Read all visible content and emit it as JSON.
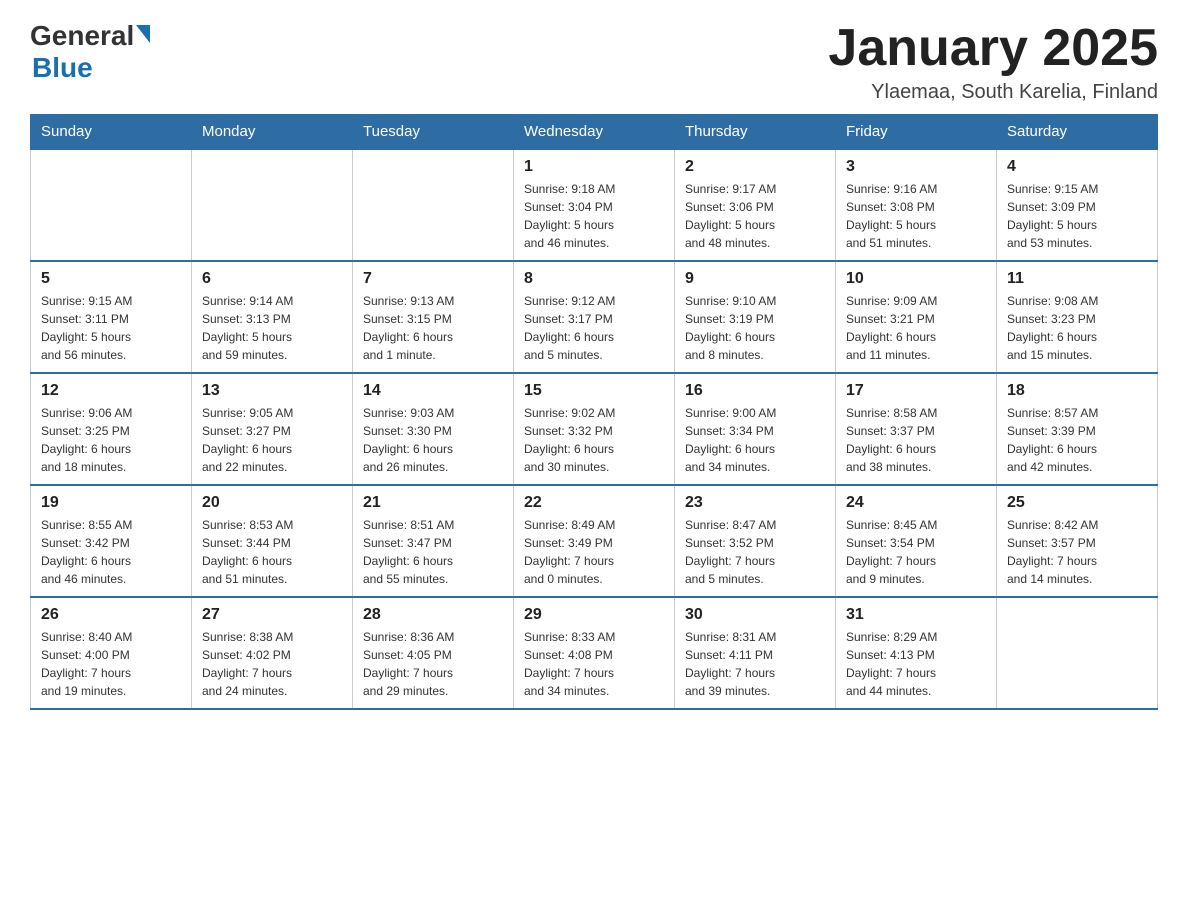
{
  "logo": {
    "general": "General",
    "blue": "Blue"
  },
  "header": {
    "title": "January 2025",
    "location": "Ylaemaa, South Karelia, Finland"
  },
  "weekdays": [
    "Sunday",
    "Monday",
    "Tuesday",
    "Wednesday",
    "Thursday",
    "Friday",
    "Saturday"
  ],
  "weeks": [
    [
      {
        "day": "",
        "info": ""
      },
      {
        "day": "",
        "info": ""
      },
      {
        "day": "",
        "info": ""
      },
      {
        "day": "1",
        "info": "Sunrise: 9:18 AM\nSunset: 3:04 PM\nDaylight: 5 hours\nand 46 minutes."
      },
      {
        "day": "2",
        "info": "Sunrise: 9:17 AM\nSunset: 3:06 PM\nDaylight: 5 hours\nand 48 minutes."
      },
      {
        "day": "3",
        "info": "Sunrise: 9:16 AM\nSunset: 3:08 PM\nDaylight: 5 hours\nand 51 minutes."
      },
      {
        "day": "4",
        "info": "Sunrise: 9:15 AM\nSunset: 3:09 PM\nDaylight: 5 hours\nand 53 minutes."
      }
    ],
    [
      {
        "day": "5",
        "info": "Sunrise: 9:15 AM\nSunset: 3:11 PM\nDaylight: 5 hours\nand 56 minutes."
      },
      {
        "day": "6",
        "info": "Sunrise: 9:14 AM\nSunset: 3:13 PM\nDaylight: 5 hours\nand 59 minutes."
      },
      {
        "day": "7",
        "info": "Sunrise: 9:13 AM\nSunset: 3:15 PM\nDaylight: 6 hours\nand 1 minute."
      },
      {
        "day": "8",
        "info": "Sunrise: 9:12 AM\nSunset: 3:17 PM\nDaylight: 6 hours\nand 5 minutes."
      },
      {
        "day": "9",
        "info": "Sunrise: 9:10 AM\nSunset: 3:19 PM\nDaylight: 6 hours\nand 8 minutes."
      },
      {
        "day": "10",
        "info": "Sunrise: 9:09 AM\nSunset: 3:21 PM\nDaylight: 6 hours\nand 11 minutes."
      },
      {
        "day": "11",
        "info": "Sunrise: 9:08 AM\nSunset: 3:23 PM\nDaylight: 6 hours\nand 15 minutes."
      }
    ],
    [
      {
        "day": "12",
        "info": "Sunrise: 9:06 AM\nSunset: 3:25 PM\nDaylight: 6 hours\nand 18 minutes."
      },
      {
        "day": "13",
        "info": "Sunrise: 9:05 AM\nSunset: 3:27 PM\nDaylight: 6 hours\nand 22 minutes."
      },
      {
        "day": "14",
        "info": "Sunrise: 9:03 AM\nSunset: 3:30 PM\nDaylight: 6 hours\nand 26 minutes."
      },
      {
        "day": "15",
        "info": "Sunrise: 9:02 AM\nSunset: 3:32 PM\nDaylight: 6 hours\nand 30 minutes."
      },
      {
        "day": "16",
        "info": "Sunrise: 9:00 AM\nSunset: 3:34 PM\nDaylight: 6 hours\nand 34 minutes."
      },
      {
        "day": "17",
        "info": "Sunrise: 8:58 AM\nSunset: 3:37 PM\nDaylight: 6 hours\nand 38 minutes."
      },
      {
        "day": "18",
        "info": "Sunrise: 8:57 AM\nSunset: 3:39 PM\nDaylight: 6 hours\nand 42 minutes."
      }
    ],
    [
      {
        "day": "19",
        "info": "Sunrise: 8:55 AM\nSunset: 3:42 PM\nDaylight: 6 hours\nand 46 minutes."
      },
      {
        "day": "20",
        "info": "Sunrise: 8:53 AM\nSunset: 3:44 PM\nDaylight: 6 hours\nand 51 minutes."
      },
      {
        "day": "21",
        "info": "Sunrise: 8:51 AM\nSunset: 3:47 PM\nDaylight: 6 hours\nand 55 minutes."
      },
      {
        "day": "22",
        "info": "Sunrise: 8:49 AM\nSunset: 3:49 PM\nDaylight: 7 hours\nand 0 minutes."
      },
      {
        "day": "23",
        "info": "Sunrise: 8:47 AM\nSunset: 3:52 PM\nDaylight: 7 hours\nand 5 minutes."
      },
      {
        "day": "24",
        "info": "Sunrise: 8:45 AM\nSunset: 3:54 PM\nDaylight: 7 hours\nand 9 minutes."
      },
      {
        "day": "25",
        "info": "Sunrise: 8:42 AM\nSunset: 3:57 PM\nDaylight: 7 hours\nand 14 minutes."
      }
    ],
    [
      {
        "day": "26",
        "info": "Sunrise: 8:40 AM\nSunset: 4:00 PM\nDaylight: 7 hours\nand 19 minutes."
      },
      {
        "day": "27",
        "info": "Sunrise: 8:38 AM\nSunset: 4:02 PM\nDaylight: 7 hours\nand 24 minutes."
      },
      {
        "day": "28",
        "info": "Sunrise: 8:36 AM\nSunset: 4:05 PM\nDaylight: 7 hours\nand 29 minutes."
      },
      {
        "day": "29",
        "info": "Sunrise: 8:33 AM\nSunset: 4:08 PM\nDaylight: 7 hours\nand 34 minutes."
      },
      {
        "day": "30",
        "info": "Sunrise: 8:31 AM\nSunset: 4:11 PM\nDaylight: 7 hours\nand 39 minutes."
      },
      {
        "day": "31",
        "info": "Sunrise: 8:29 AM\nSunset: 4:13 PM\nDaylight: 7 hours\nand 44 minutes."
      },
      {
        "day": "",
        "info": ""
      }
    ]
  ]
}
